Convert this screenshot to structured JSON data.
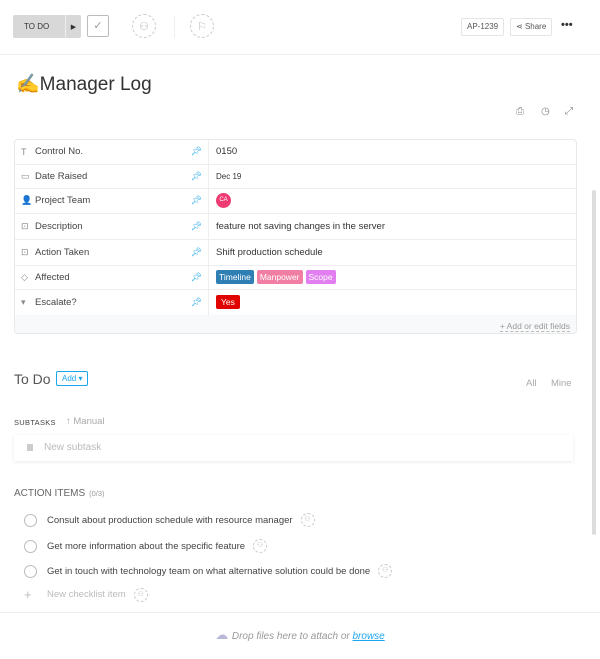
{
  "header": {
    "status": "TO DO",
    "task_id": "AP-1239",
    "share": "Share",
    "more": "•••"
  },
  "title": "Manager Log",
  "title_emoji": "✍️",
  "fields": [
    {
      "icon": "T",
      "label": "Control No.",
      "value": "0150"
    },
    {
      "icon": "▭",
      "label": "Date Raised",
      "value": "Dec 19"
    },
    {
      "icon": "👤",
      "label": "Project Team",
      "avatar": "CA"
    },
    {
      "icon": "⊡",
      "label": "Description",
      "value": "feature not saving changes in the server"
    },
    {
      "icon": "⊡",
      "label": "Action Taken",
      "value": "Shift production schedule"
    },
    {
      "icon": "◇",
      "label": "Affected",
      "tags": [
        {
          "text": "Timeline",
          "color": "#2f7fb5"
        },
        {
          "text": "Manpower",
          "color": "#f17fa4"
        },
        {
          "text": "Scope",
          "color": "#e27ff0"
        }
      ]
    },
    {
      "icon": "▾",
      "label": "Escalate?",
      "tag": {
        "text": "Yes",
        "color": "#e00000"
      }
    }
  ],
  "fields_footer": "+ Add or edit fields",
  "todo": {
    "title": "To Do",
    "add": "Add ▾",
    "all": "All",
    "mine": "Mine"
  },
  "subtasks": {
    "heading": "SUBTASKS",
    "sort": "↑ Manual",
    "placeholder": "New subtask"
  },
  "action_items": {
    "heading": "ACTION ITEMS",
    "count": "(0/3)",
    "items": [
      "Consult about production schedule with resource manager",
      "Get more information about the specific feature",
      "Get in touch with technology team on what alternative solution could be done"
    ],
    "new": "New checklist item"
  },
  "drop": {
    "text": "Drop files here to attach or ",
    "link": "browse"
  }
}
